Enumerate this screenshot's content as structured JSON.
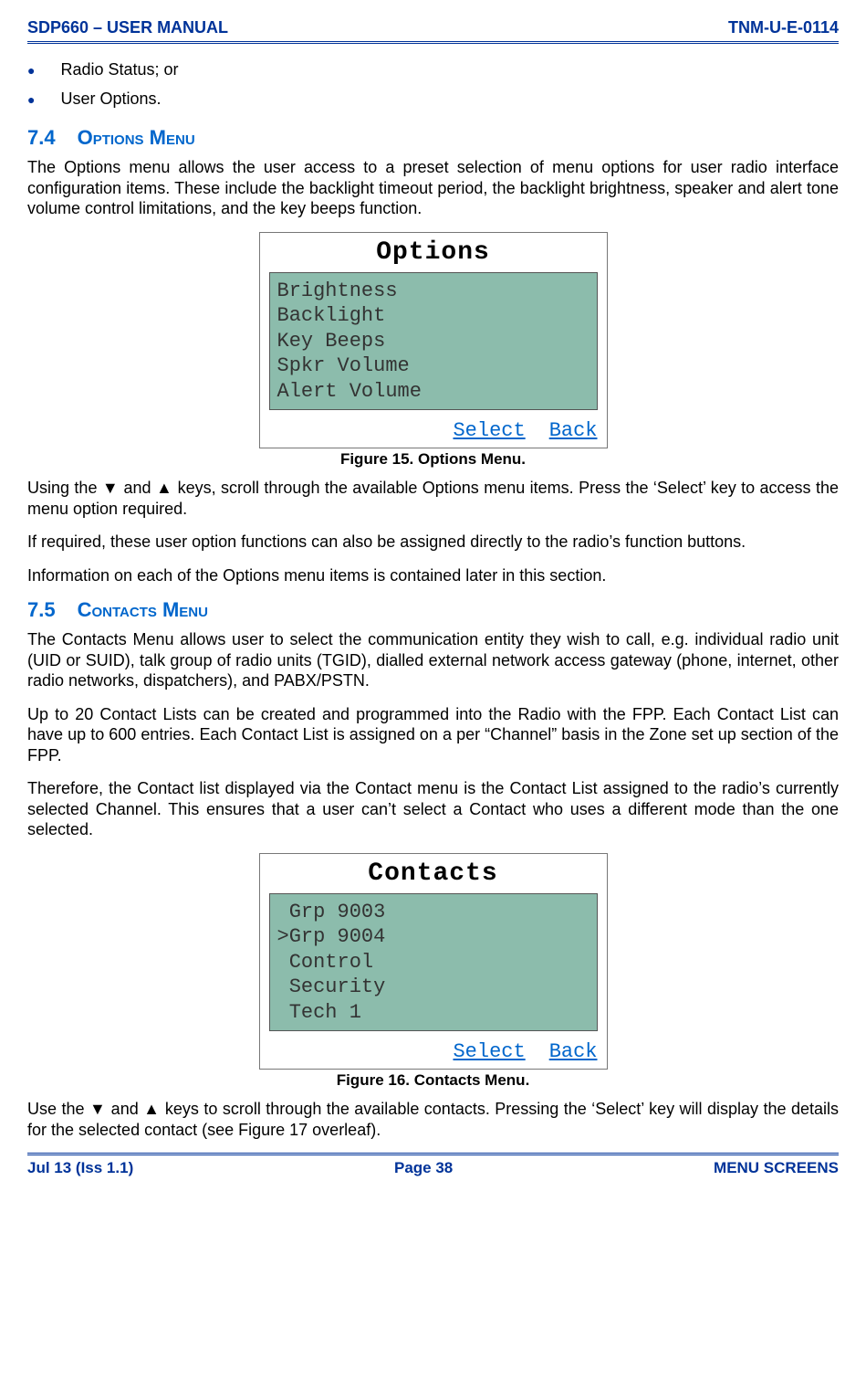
{
  "header": {
    "left": "SDP660 – USER MANUAL",
    "right": "TNM-U-E-0114"
  },
  "bullets": [
    "Radio Status; or",
    "User Options."
  ],
  "sec74": {
    "num": "7.4",
    "title": "Options Menu",
    "p1": "The Options menu allows the user access to a preset selection of menu options for user radio interface configuration items.  These include the backlight timeout period, the backlight brightness, speaker and alert tone volume control limitations, and the key beeps function.",
    "screen": {
      "title": "Options",
      "items": [
        "Brightness",
        "Backlight",
        "Key Beeps",
        "Spkr Volume",
        "Alert Volume"
      ],
      "soft_select": "Select",
      "soft_back": "Back"
    },
    "figcap": "Figure 15.  Options Menu.",
    "p2": "Using the ▼ and ▲ keys, scroll through the available Options menu items.  Press the ‘Select’ key to access the menu option required.",
    "p3": "If required, these user option functions can also be assigned directly to the radio’s function buttons.",
    "p4": "Information on each of the Options menu items is contained later in this section."
  },
  "sec75": {
    "num": "7.5",
    "title": "Contacts Menu",
    "p1": "The Contacts Menu allows user to select the communication entity they wish to call, e.g. individual radio unit (UID or SUID), talk group of radio units (TGID), dialled external network access gateway (phone, internet, other radio networks, dispatchers), and PABX/PSTN.",
    "p2": "Up to 20 Contact Lists can be created and programmed into the Radio with the FPP.  Each Contact List can have up to 600 entries.  Each Contact List is assigned on a per “Channel” basis in the Zone set up section of the FPP.",
    "p3": "Therefore, the Contact list displayed via the Contact menu is the Contact List assigned to the radio’s currently selected Channel.  This ensures that a user can’t select a Contact who uses a different mode than the one selected.",
    "screen": {
      "title": "Contacts",
      "items": [
        " Grp 9003",
        ">Grp 9004",
        " Control",
        " Security",
        " Tech 1"
      ],
      "soft_select": "Select",
      "soft_back": "Back"
    },
    "figcap": "Figure 16.  Contacts Menu.",
    "p4": "Use the ▼ and ▲ keys to scroll through the available contacts.  Pressing the ‘Select’ key will display the details for the selected contact (see Figure 17 overleaf)."
  },
  "footer": {
    "left": "Jul 13 (Iss 1.1)",
    "center": "Page 38",
    "right": "MENU SCREENS"
  }
}
